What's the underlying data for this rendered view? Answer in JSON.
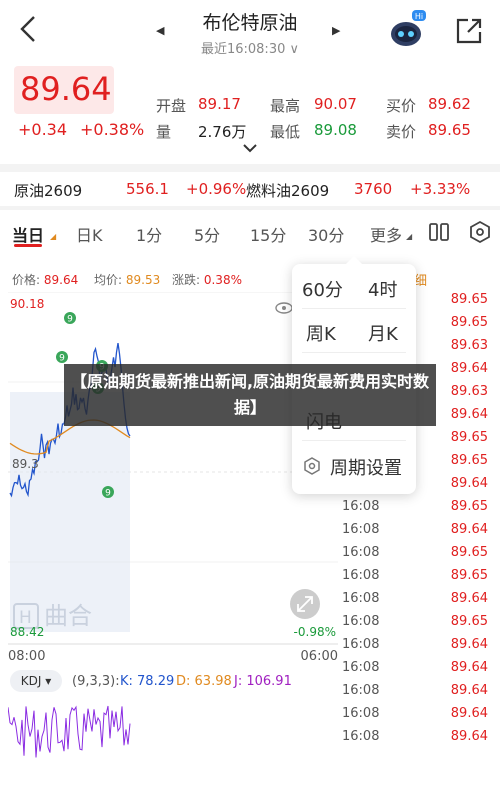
{
  "header": {
    "title": "布伦特原油",
    "subtitle": "最近16:08:30 ∨",
    "prev_icon": "triangle-left-icon",
    "next_icon": "triangle-right-icon",
    "badge": "Hi"
  },
  "quote": {
    "price": "89.64",
    "change": "+0.34",
    "change_pct": "+0.38%",
    "open_label": "开盘",
    "open": "89.17",
    "high_label": "最高",
    "high": "90.07",
    "bid_label": "买价",
    "bid": "89.62",
    "vol_label": "量",
    "vol": "2.76万",
    "low_label": "最低",
    "low": "89.08",
    "ask_label": "卖价",
    "ask": "89.65"
  },
  "related": {
    "item1_name": "原油2609",
    "item1_price": "556.1",
    "item1_pct": "+0.96%",
    "item2_name": "燃料油2609",
    "item2_price": "3760",
    "item2_pct": "+3.33%"
  },
  "tabs": [
    "当日",
    "日K",
    "1分",
    "5分",
    "15分",
    "30分",
    "更多"
  ],
  "info": {
    "price_label": "价格: ",
    "price": "89.64",
    "avg_label": "均价: ",
    "avg": "89.53",
    "chg_label": "涨跌: ",
    "chg": "0.38%"
  },
  "chart": {
    "top_value": "90.18",
    "mid_value": "89.3",
    "bottom_value": "88.42",
    "bottom_pct": "-0.98%",
    "start_time": "08:00",
    "end_time": "06:00",
    "watermark": "曲合",
    "markers": [
      "9",
      "9",
      "9",
      "9",
      "9"
    ]
  },
  "ticks": [
    {
      "time": "",
      "price": "89.65"
    },
    {
      "time": "",
      "price": "89.65"
    },
    {
      "time": "",
      "price": "89.63"
    },
    {
      "time": "",
      "price": "89.64"
    },
    {
      "time": "",
      "price": "89.63"
    },
    {
      "time": "",
      "price": "89.64"
    },
    {
      "time": "",
      "price": "89.65"
    },
    {
      "time": "",
      "price": "89.65"
    },
    {
      "time": "16:08",
      "price": "89.64"
    },
    {
      "time": "16:08",
      "price": "89.65"
    },
    {
      "time": "16:08",
      "price": "89.64"
    },
    {
      "time": "16:08",
      "price": "89.65"
    },
    {
      "time": "16:08",
      "price": "89.65"
    },
    {
      "time": "16:08",
      "price": "89.64"
    },
    {
      "time": "16:08",
      "price": "89.65"
    },
    {
      "time": "16:08",
      "price": "89.64"
    },
    {
      "time": "16:08",
      "price": "89.64"
    },
    {
      "time": "16:08",
      "price": "89.64"
    },
    {
      "time": "16:08",
      "price": "89.64"
    },
    {
      "time": "16:08",
      "price": "89.64"
    }
  ],
  "popup": {
    "item_60": "60分",
    "item_4h": "4时",
    "item_week": "周K",
    "item_month": "月K",
    "item_flash": "闪电",
    "settings": "周期设置"
  },
  "banner": {
    "text": "【原油期货最新推出新闻,原油期货最新费用实时数据】"
  },
  "kdj": {
    "button": "KDJ ▾",
    "params": "(9,3,3):",
    "k": "K: 78.29",
    "d": "D: 63.98",
    "j": "J: 106.91"
  },
  "colors": {
    "up": "#e02020",
    "down": "#1a9a3a",
    "price_line": "#2255cc"
  }
}
